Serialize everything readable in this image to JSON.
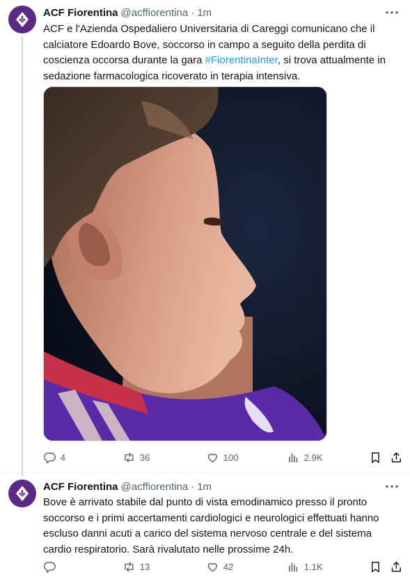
{
  "tweets": [
    {
      "author_name": "ACF Fiorentina",
      "handle": "@acffiorentina",
      "separator": "·",
      "time": "1m",
      "text_before": "ACF e l'Azienda Ospedaliero Universitaria di Careggi comunicano che il calciatore Edoardo Bove, soccorso in campo a seguito della perdita di coscienza occorsa durante la gara ",
      "hashtag": "#FiorentinaInter",
      "text_after": ", si trova attualmente in sedazione farmacologica ricoverato in terapia intensiva.",
      "replies": "4",
      "retweets": "36",
      "likes": "100",
      "views": "2.9K"
    },
    {
      "author_name": "ACF Fiorentina",
      "handle": "@acffiorentina",
      "separator": "·",
      "time": "1m",
      "text_before": "Bove è  arrivato stabile dal punto di vista emodinamico presso il pronto soccorso e i primi accertamenti cardiologici e neurologici effettuati hanno escluso danni acuti a carico del sistema nervoso centrale e del sistema cardio respiratorio. Sarà rivalutato nelle prossime 24h.",
      "replies": "",
      "retweets": "13",
      "likes": "42",
      "views": "1.1K"
    }
  ],
  "icons": {
    "avatar": "fiorentina-fleur-de-lis-logo",
    "more": "more-dots-icon",
    "reply": "reply-icon",
    "retweet": "retweet-icon",
    "like": "heart-icon",
    "views": "views-chart-icon",
    "bookmark": "bookmark-icon",
    "share": "share-icon"
  },
  "colors": {
    "text": "#0f1419",
    "secondary": "#536471",
    "link": "#1d9bf0",
    "avatar_bg": "#5b2a86",
    "thread_line": "#cfd9de"
  }
}
